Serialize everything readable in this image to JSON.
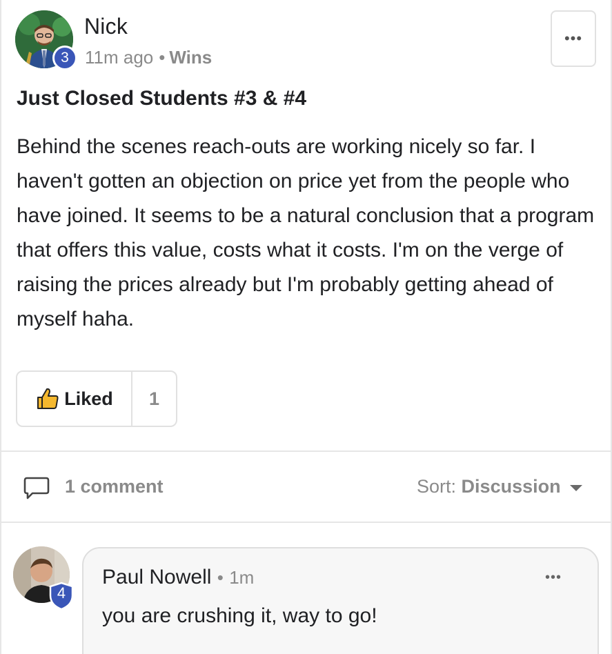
{
  "post": {
    "author": "Nick",
    "level": "3",
    "time_ago": "11m ago",
    "separator": "•",
    "category": "Wins",
    "more_label": "•••",
    "title": "Just Closed Students #3 & #4",
    "body": "Behind the scenes reach-outs are working nicely so far. I haven't gotten an objection on price yet from the people who have joined. It seems to be a natural conclusion that a program that offers this value, costs what it costs. I'm on the verge of raising the prices already but I'm probably getting ahead of myself haha.",
    "like_label": "Liked",
    "like_count": "1"
  },
  "comments_bar": {
    "count_label": "1 comment",
    "sort_prefix": "Sort:",
    "sort_value": "Discussion"
  },
  "comments": [
    {
      "author": "Paul Nowell",
      "separator": "•",
      "time": "1m",
      "level": "4",
      "text": "you are crushing it, way to go!",
      "more_label": "•••"
    }
  ],
  "colors": {
    "level_badge": "#3a56b8",
    "muted_text": "#8a8a8a",
    "like_icon": "#f5b82e"
  }
}
